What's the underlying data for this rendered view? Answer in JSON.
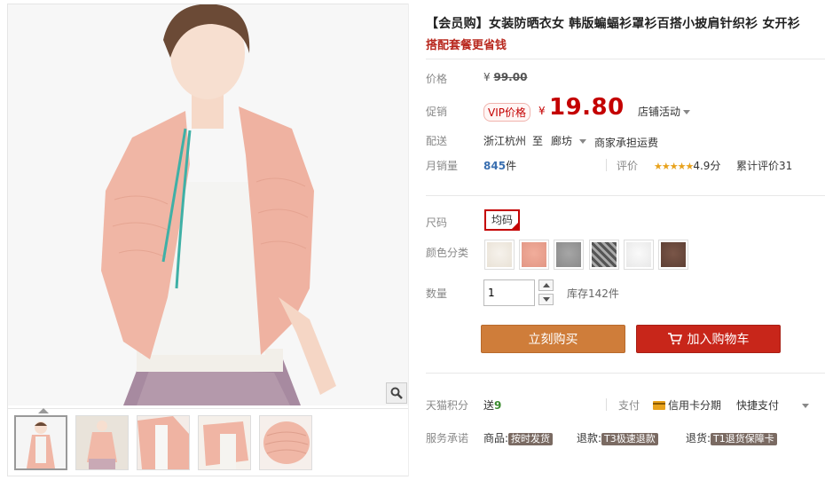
{
  "product": {
    "title": "【会员购】女装防晒衣女 韩版蝙蝠衫罩衫百搭小披肩针织衫 女开衫",
    "subtitle": "搭配套餐更省钱"
  },
  "price": {
    "label": "价格",
    "yen": "¥",
    "original": "99.00"
  },
  "promo": {
    "label": "促销",
    "vip_badge": "VIP价格",
    "yen": "¥",
    "price": "19.80",
    "store_activity": "店铺活动"
  },
  "shipping": {
    "label": "配送",
    "from": "浙江杭州",
    "to_word": "至",
    "to": "廊坊",
    "fee": "商家承担运费"
  },
  "sales": {
    "label": "月销量",
    "count": "845",
    "unit": "件",
    "rating_label": "评价",
    "stars": "★★★★★",
    "score": "4.9分",
    "reviews": "累计评价31"
  },
  "size": {
    "label": "尺码",
    "value": "均码"
  },
  "color": {
    "label": "颜色分类",
    "swatches": [
      "#f0ebe3",
      "#eba08e",
      "#9c9c9c",
      "#6f6f6f",
      "#f4f4f4",
      "#6b4a3e"
    ]
  },
  "quantity": {
    "label": "数量",
    "value": "1",
    "stock": "库存142件"
  },
  "buttons": {
    "buy_now": "立刻购买",
    "add_cart": "加入购物车"
  },
  "points": {
    "label": "天猫积分",
    "send": "送",
    "amount": "9",
    "pay_label": "支付",
    "credit": "信用卡分期",
    "quick_pay": "快捷支付"
  },
  "service": {
    "label": "服务承诺",
    "goods": "商品:",
    "goods_tag": "按时发货",
    "refund": "退款:",
    "refund_tag": "T3极速退款",
    "return": "退货:",
    "return_tag": "T1退货保障卡"
  },
  "colors": {
    "accent_red": "#c40000",
    "buy_button": "#cf7d3a",
    "cart_button": "#c8261a"
  }
}
